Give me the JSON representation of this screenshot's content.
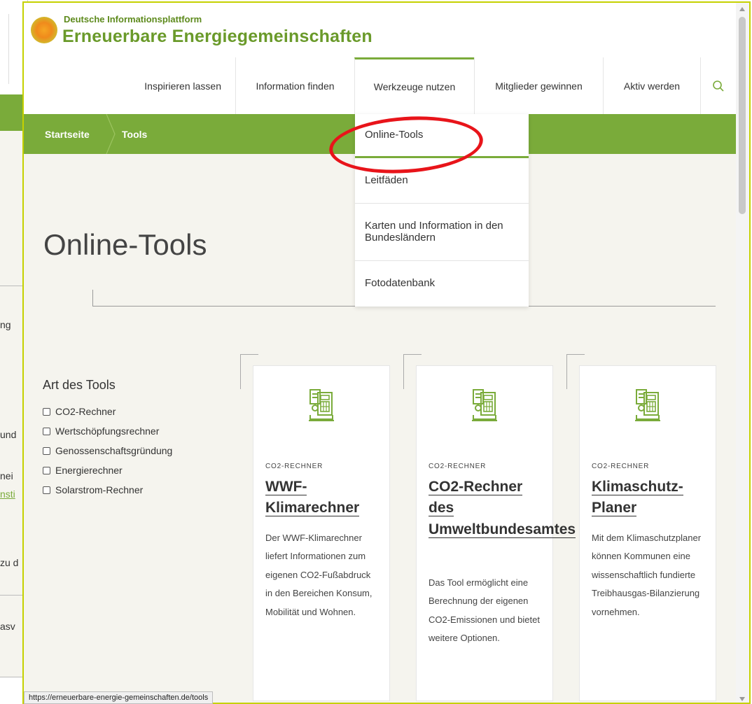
{
  "background_window": {
    "fragments": [
      "ng",
      "und",
      "nei",
      "nsti",
      "zu d",
      "asv"
    ]
  },
  "header": {
    "brand_top": "Deutsche Informationsplattform",
    "brand_main": "Erneuerbare Energiegemeinschaften"
  },
  "nav": {
    "items": [
      "Inspirieren lassen",
      "Information finden",
      "Werkzeuge nutzen",
      "Mitglieder gewinnen",
      "Aktiv werden"
    ],
    "active": "Werkzeuge nutzen"
  },
  "breadcrumb": {
    "home": "Startseite",
    "current": "Tools"
  },
  "dropdown": {
    "items": [
      "Online-Tools",
      "Leitfäden",
      "Karten und Information in den Bundesländern",
      "Fotodatenbank"
    ],
    "highlighted": "Online-Tools"
  },
  "page": {
    "title": "Online-Tools"
  },
  "filter": {
    "heading": "Art des Tools",
    "options": [
      "CO2-Rechner",
      "Wertschöpfungsrechner",
      "Genossenschaftsgründung",
      "Energierechner",
      "Solarstrom-Rechner"
    ]
  },
  "cards": [
    {
      "category": "CO2-RECHNER",
      "title": "WWF-Klimarechner",
      "text": "Der WWF-Klimarechner liefert Informationen zum eigenen CO2-Fußabdruck in den Bereichen Konsum, Mobilität und Wohnen."
    },
    {
      "category": "CO2-RECHNER",
      "title": "CO2-Rechner des Umweltbundesamtes",
      "text": "Das Tool ermöglicht eine Berechnung der eigenen CO2-Emissionen und bietet weitere Optionen."
    },
    {
      "category": "CO2-RECHNER",
      "title": "Klimaschutz-Planer",
      "text": "Mit dem Klimaschutzplaner können Kommunen eine wissenschaftlich fundierte Treibhausgas-Bilanzierung vornehmen."
    }
  ],
  "status_bar": {
    "url": "https://erneuerbare-energie-gemeinschaften.de/tools"
  },
  "colors": {
    "brand_green": "#7aab3a",
    "annotation_red": "#e8141a",
    "window_border": "#c5d100",
    "page_bg": "#f5f4ee"
  }
}
